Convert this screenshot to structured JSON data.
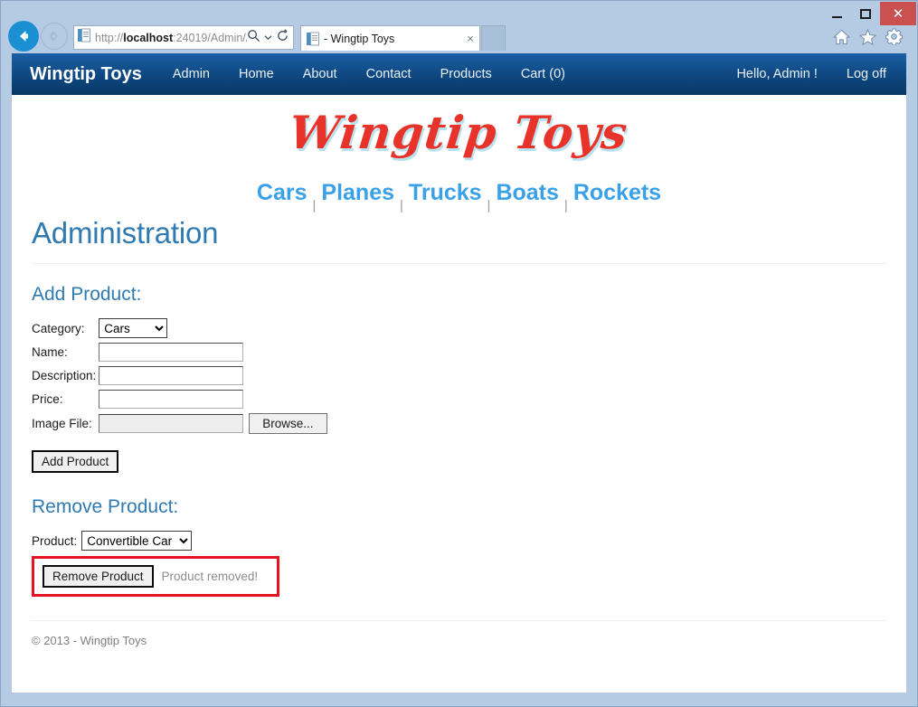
{
  "browser": {
    "address_url_prefix": "http://",
    "address_url_host": "localhost",
    "address_url_rest": ":24019/Admin/A",
    "search_icon": "search-icon",
    "dropdown_icon": "chevron-down-icon",
    "refresh_icon": "refresh-icon",
    "back_icon": "back-arrow-icon",
    "forward_icon": "forward-arrow-icon",
    "tab_title": "- Wingtip Toys",
    "tab_close_label": "×",
    "new_tab_label": "",
    "home_icon": "home-icon",
    "favorites_icon": "star-icon",
    "tools_icon": "gear-icon",
    "minimize_label": "",
    "maximize_label": "",
    "close_label": "✕"
  },
  "nav": {
    "brand": "Wingtip Toys",
    "items": [
      {
        "label": "Admin"
      },
      {
        "label": "Home"
      },
      {
        "label": "About"
      },
      {
        "label": "Contact"
      },
      {
        "label": "Products"
      },
      {
        "label": "Cart (0)"
      }
    ],
    "greeting": "Hello, Admin !",
    "logoff": "Log off"
  },
  "site": {
    "logo_text": "Wingtip Toys",
    "categories": [
      {
        "label": "Cars"
      },
      {
        "label": "Planes"
      },
      {
        "label": "Trucks"
      },
      {
        "label": "Boats"
      },
      {
        "label": "Rockets"
      }
    ],
    "category_separator": "|"
  },
  "page": {
    "title": "Administration",
    "add_section_title": "Add Product:",
    "remove_section_title": "Remove Product:",
    "fields": {
      "category_label": "Category:",
      "category_value": "Cars",
      "name_label": "Name:",
      "name_value": "",
      "name_placeholder": "",
      "description_label": "Description:",
      "description_value": "",
      "description_placeholder": "",
      "price_label": "Price:",
      "price_value": "",
      "price_placeholder": "",
      "image_file_label": "Image File:",
      "image_file_value": "",
      "browse_label": "Browse..."
    },
    "add_product_button": "Add Product",
    "product_label": "Product:",
    "product_value": "Convertible Car",
    "remove_product_button": "Remove Product",
    "remove_status": "Product removed!",
    "footer": "© 2013 - Wingtip Toys"
  },
  "colors": {
    "nav_top": "#1b5fa5",
    "nav_bottom": "#083964",
    "heading_blue": "#2f7ab0",
    "category_blue": "#3aa0e8",
    "logo_red": "#e8332a",
    "highlight_red": "#e81123",
    "frame_blue": "#b5cbe4"
  }
}
